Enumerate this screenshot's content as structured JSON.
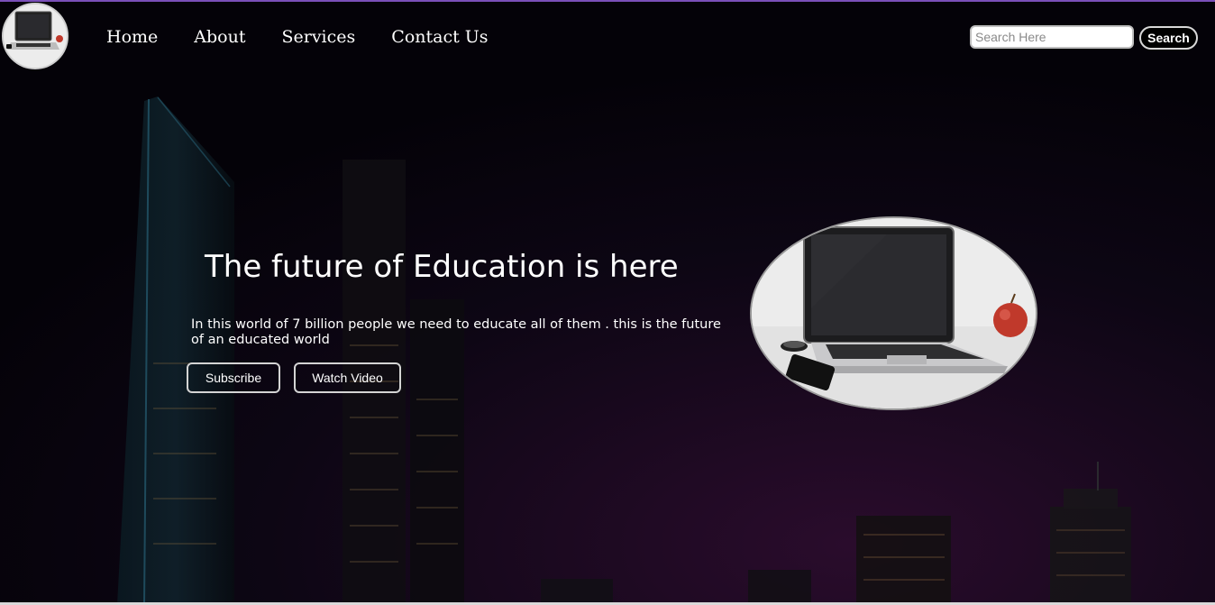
{
  "nav": {
    "logo_icon": "laptop-logo-icon",
    "links": [
      {
        "label": "Home"
      },
      {
        "label": "About"
      },
      {
        "label": "Services"
      },
      {
        "label": "Contact Us"
      }
    ],
    "search": {
      "placeholder": "Search Here",
      "value": "",
      "button_label": "Search"
    }
  },
  "hero": {
    "title": "The future of Education is here",
    "text": "In this world of 7 billion people we need to educate all of them . this is the future of an educated world",
    "buttons": {
      "subscribe": "Subscribe",
      "watch_video": "Watch Video"
    },
    "image_icon": "laptop-photo-icon"
  },
  "colors": {
    "background": "#07040c",
    "accent_border": "#7a4fb8",
    "text": "#ffffff"
  }
}
